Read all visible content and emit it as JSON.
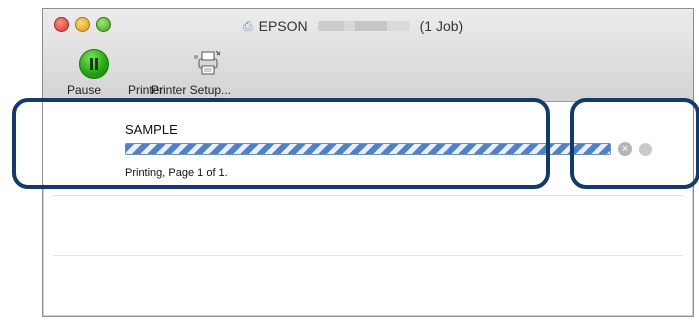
{
  "window": {
    "title_prefix": "EPSON",
    "title_suffix": "(1 Job)",
    "title_icon": "printer-queue-icon"
  },
  "toolbar": {
    "pause_label": "Pause",
    "printer_label": "Printer",
    "setup_label": "Printer Setup..."
  },
  "job": {
    "name": "SAMPLE",
    "status": "Printing, Page 1 of 1.",
    "progress": 1.0
  },
  "colors": {
    "highlight": "#143a68",
    "progress": "#4f80c8"
  }
}
